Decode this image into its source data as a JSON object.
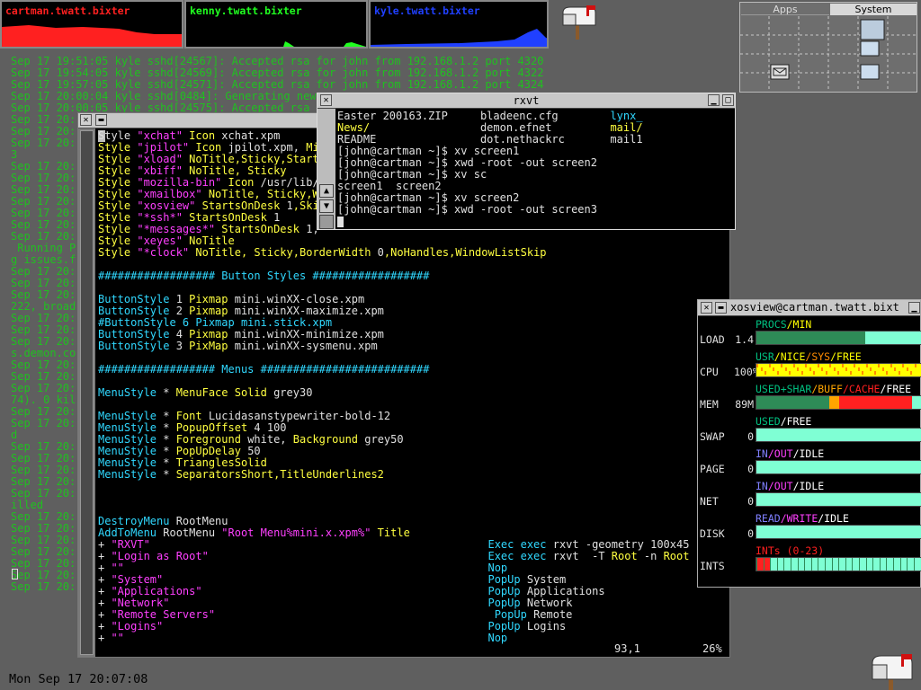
{
  "load_monitors": [
    {
      "label": "cartman.twatt.bixter",
      "color": "#ff2020"
    },
    {
      "label": "kenny.twatt.bixter",
      "color": "#20ff20"
    },
    {
      "label": "kyle.twatt.bixter",
      "color": "#2040ff"
    }
  ],
  "pager": {
    "tabs": [
      "Apps",
      "System"
    ]
  },
  "background_log": [
    "Sep 17 19:51:05 kyle sshd[24567]: Accepted rsa for john from 192.168.1.2 port 4320",
    "Sep 17 19:54:05 kyle sshd[24569]: Accepted rsa for john from 192.168.1.2 port 4322",
    "Sep 17 19:57:05 kyle sshd[24571]: Accepted rsa for john from 192.168.1.2 port 4324",
    "Sep 17 20:00:04 kyle sshd[0484]: Generating new",
    "Sep 17 20:00:05 kyle sshd[24575]: Accepted rsa f",
    "Sep 17 20:",
    "Sep 17 20:",
    "Sep 17 20:",
    "3",
    "Sep 17 20:",
    "Sep 17 20:",
    "Sep 17 20:",
    "Sep 17 20:",
    "Sep 17 20:",
    "Sep 17 20:",
    "Sep 17 20:",
    " Running P",
    "g issues.f",
    "Sep 17 20:",
    "Sep 17 20:",
    "Sep 17 20:",
    "222, broad",
    "Sep 17 20:",
    "Sep 17 20:",
    "Sep 17 20:",
    "s.demon.co",
    "Sep 17 20:",
    "Sep 17 20:",
    "Sep 17 20:",
    "74). 0 kil",
    "Sep 17 20:",
    "Sep 17 20:",
    "d",
    "Sep 17 20:",
    "Sep 17 20:",
    "Sep 17 20:",
    "Sep 17 20:",
    "Sep 17 20:",
    "illed",
    "Sep 17 20:",
    "Sep 17 20:",
    "Sep 17 20:",
    "Sep 17 20:",
    "Sep 17 20:",
    "Sep 17 20:",
    "Sep 17 20:"
  ],
  "vim": {
    "lines": [
      [
        [
          "w",
          "Style "
        ],
        [
          "m",
          "\"xchat\""
        ],
        [
          "y",
          " Icon "
        ],
        [
          "w",
          "xchat.xpm"
        ]
      ],
      [
        [
          "y",
          "Style "
        ],
        [
          "m",
          "\"jpilot\""
        ],
        [
          "y",
          " Icon "
        ],
        [
          "w",
          "jpilot.xpm, "
        ],
        [
          "y",
          "Min"
        ]
      ],
      [
        [
          "y",
          "Style "
        ],
        [
          "m",
          "\"xload\""
        ],
        [
          "y",
          " NoTitle,Sticky,StartsO"
        ]
      ],
      [
        [
          "y",
          "Style "
        ],
        [
          "m",
          "\"xbiff\""
        ],
        [
          "y",
          " NoTitle, Sticky"
        ]
      ],
      [
        [
          "y",
          "Style "
        ],
        [
          "m",
          "\"mozilla-bin\""
        ],
        [
          "y",
          " Icon "
        ],
        [
          "w",
          "/usr/lib/m"
        ]
      ],
      [
        [
          "y",
          "Style "
        ],
        [
          "m",
          "\"xmailbox\""
        ],
        [
          "y",
          " NoTitle, Sticky,Wi"
        ]
      ],
      [
        [
          "y",
          "Style "
        ],
        [
          "m",
          "\"xosview\""
        ],
        [
          "y",
          " StartsOnDesk "
        ],
        [
          "w",
          "1"
        ],
        [
          "y",
          ",Skip"
        ]
      ],
      [
        [
          "y",
          "Style "
        ],
        [
          "m",
          "\"*ssh*\""
        ],
        [
          "y",
          " StartsOnDesk "
        ],
        [
          "w",
          "1"
        ]
      ],
      [
        [
          "y",
          "Style "
        ],
        [
          "m",
          "\"*messages*\""
        ],
        [
          "y",
          " StartsOnDesk "
        ],
        [
          "w",
          "1,"
        ]
      ],
      [
        [
          "y",
          "Style "
        ],
        [
          "m",
          "\"xeyes\""
        ],
        [
          "y",
          " NoTitle"
        ]
      ],
      [
        [
          "y",
          "Style "
        ],
        [
          "m",
          "\"*clock\""
        ],
        [
          "y",
          " NoTitle, Sticky,BorderWidth "
        ],
        [
          "w",
          "0"
        ],
        [
          "y",
          ",NoHandles,WindowListSkip"
        ]
      ],
      [],
      [
        [
          "c",
          "################## Button Styles ##################"
        ]
      ],
      [],
      [
        [
          "c",
          "ButtonStyle "
        ],
        [
          "w",
          "1 "
        ],
        [
          "y",
          "Pixmap "
        ],
        [
          "w",
          "mini.winXX-close.xpm"
        ]
      ],
      [
        [
          "c",
          "ButtonStyle "
        ],
        [
          "w",
          "2 "
        ],
        [
          "y",
          "Pixmap "
        ],
        [
          "w",
          "mini.winXX-maximize.xpm"
        ]
      ],
      [
        [
          "c",
          "#ButtonStyle 6 Pixmap mini.stick.xpm"
        ]
      ],
      [
        [
          "c",
          "ButtonStyle "
        ],
        [
          "w",
          "4 "
        ],
        [
          "y",
          "Pixmap "
        ],
        [
          "w",
          "mini.winXX-minimize.xpm"
        ]
      ],
      [
        [
          "c",
          "ButtonStyle "
        ],
        [
          "w",
          "3 "
        ],
        [
          "y",
          "PixMap "
        ],
        [
          "w",
          "mini.winXX-sysmenu.xpm"
        ]
      ],
      [],
      [
        [
          "c",
          "################## Menus ##########################"
        ]
      ],
      [],
      [
        [
          "c",
          "MenuStyle "
        ],
        [
          "w",
          "* "
        ],
        [
          "y",
          "MenuFace Solid "
        ],
        [
          "w",
          "grey30"
        ]
      ],
      [],
      [
        [
          "c",
          "MenuStyle "
        ],
        [
          "w",
          "* "
        ],
        [
          "y",
          "Font "
        ],
        [
          "w",
          "Lucidasanstypewriter-bold-12"
        ]
      ],
      [
        [
          "c",
          "MenuStyle "
        ],
        [
          "w",
          "* "
        ],
        [
          "y",
          "PopupOffset "
        ],
        [
          "w",
          "4 100"
        ]
      ],
      [
        [
          "c",
          "MenuStyle "
        ],
        [
          "w",
          "* "
        ],
        [
          "y",
          "Foreground "
        ],
        [
          "w",
          "white, "
        ],
        [
          "y",
          "Background "
        ],
        [
          "w",
          "grey50"
        ]
      ],
      [
        [
          "c",
          "MenuStyle "
        ],
        [
          "w",
          "* "
        ],
        [
          "y",
          "PopUpDelay "
        ],
        [
          "w",
          "50"
        ]
      ],
      [
        [
          "c",
          "MenuStyle "
        ],
        [
          "w",
          "* "
        ],
        [
          "y",
          "TrianglesSolid"
        ]
      ],
      [
        [
          "c",
          "MenuStyle "
        ],
        [
          "w",
          "* "
        ],
        [
          "y",
          "SeparatorsShort,TitleUnderlines2"
        ]
      ],
      [],
      [],
      [],
      [
        [
          "c",
          "DestroyMenu "
        ],
        [
          "w",
          "RootMenu"
        ]
      ],
      [
        [
          "c",
          "AddToMenu "
        ],
        [
          "w",
          "RootMenu "
        ],
        [
          "m",
          "\"Root Menu%mini.x.xpm%\""
        ],
        [
          "y",
          " Title"
        ]
      ],
      [
        [
          "w",
          "+ "
        ],
        [
          "m",
          "\"RXVT\"                                                    "
        ],
        [
          "c",
          "Exec exec "
        ],
        [
          "w",
          "rxvt -geometry 100x45"
        ]
      ],
      [
        [
          "w",
          "+ "
        ],
        [
          "m",
          "\"Login as Root\"                                           "
        ],
        [
          "c",
          "Exec exec "
        ],
        [
          "w",
          "rxvt  -T "
        ],
        [
          "y",
          "Root "
        ],
        [
          "w",
          "-n "
        ],
        [
          "y",
          "Root "
        ],
        [
          "w",
          "-g"
        ]
      ],
      [
        [
          "w",
          "+ "
        ],
        [
          "m",
          "\"\"                                                        "
        ],
        [
          "c",
          "Nop"
        ]
      ],
      [
        [
          "w",
          "+ "
        ],
        [
          "m",
          "\"System\"                                                  "
        ],
        [
          "c",
          "PopUp "
        ],
        [
          "w",
          "System"
        ]
      ],
      [
        [
          "w",
          "+ "
        ],
        [
          "m",
          "\"Applications\"                                            "
        ],
        [
          "c",
          "PopUp "
        ],
        [
          "w",
          "Applications"
        ]
      ],
      [
        [
          "w",
          "+ "
        ],
        [
          "m",
          "\"Network\"                                                 "
        ],
        [
          "c",
          "PopUp "
        ],
        [
          "w",
          "Network"
        ]
      ],
      [
        [
          "w",
          "+ "
        ],
        [
          "m",
          "\"Remote Servers\"                                          "
        ],
        [
          "c",
          " PopUp "
        ],
        [
          "w",
          "Remote"
        ]
      ],
      [
        [
          "w",
          "+ "
        ],
        [
          "m",
          "\"Logins\"                                                  "
        ],
        [
          "c",
          "PopUp "
        ],
        [
          "w",
          "Logins"
        ]
      ],
      [
        [
          "w",
          "+ "
        ],
        [
          "m",
          "\"\"                                                        "
        ],
        [
          "c",
          "Nop"
        ]
      ]
    ],
    "ruler_pos": "93,1",
    "ruler_pct": "26%"
  },
  "rxvt": {
    "title": "rxvt",
    "lines": [
      [
        [
          "w",
          "Easter 200163.ZIP     bladeenc.cfg        "
        ],
        [
          "c",
          "lynx_"
        ]
      ],
      [
        [
          "y",
          "News/                 "
        ],
        [
          "w",
          "demon.efnet         "
        ],
        [
          "y",
          "mail/"
        ]
      ],
      [
        [
          "w",
          "README                dot.nethackrc       mail1"
        ]
      ],
      [
        [
          "w",
          "[john@cartman ~]$ xv screen1"
        ]
      ],
      [
        [
          "w",
          "[john@cartman ~]$ xwd -root -out screen2"
        ]
      ],
      [
        [
          "w",
          "[john@cartman ~]$ xv sc"
        ]
      ],
      [
        [
          "w",
          "screen1  screen2"
        ]
      ],
      [
        [
          "w",
          "[john@cartman ~]$ xv screen2"
        ]
      ],
      [
        [
          "w",
          "[john@cartman ~]$ xwd -root -out screen3"
        ]
      ]
    ]
  },
  "xosview": {
    "title": "xosview@cartman.twatt.bixt",
    "meters": [
      {
        "name": "LOAD",
        "value": "1.4",
        "legend": [
          [
            "#00c080",
            "PROCS"
          ],
          [
            "#ffff00",
            "/MIN"
          ]
        ],
        "segments": [
          [
            "#2e8b57",
            0.66
          ],
          [
            "#7fffd4",
            0.34
          ]
        ]
      },
      {
        "name": "CPU",
        "value": "100%",
        "legend": [
          [
            "#00c080",
            "USR"
          ],
          [
            "#ffff00",
            "/NICE"
          ],
          [
            "#ff8c00",
            "/SYS"
          ],
          [
            "#ffff00",
            "/FREE"
          ]
        ],
        "segments": [
          [
            "#ffff00",
            1.0
          ]
        ]
      },
      {
        "name": "MEM",
        "value": "89M",
        "legend": [
          [
            "#00c080",
            "USED+SHAR"
          ],
          [
            "#ffa500",
            "/BUFF"
          ],
          [
            "#ff2020",
            "/CACHE"
          ],
          [
            "#ffffff",
            "/FREE"
          ]
        ],
        "segments": [
          [
            "#2e8b57",
            0.44
          ],
          [
            "#ffa500",
            0.06
          ],
          [
            "#ff2020",
            0.44
          ],
          [
            "#7fffd4",
            0.06
          ]
        ]
      },
      {
        "name": "SWAP",
        "value": "0",
        "legend": [
          [
            "#00c080",
            "USED"
          ],
          [
            "#ffffff",
            "/FREE"
          ]
        ],
        "segments": [
          [
            "#7fffd4",
            1.0
          ]
        ]
      },
      {
        "name": "PAGE",
        "value": "0",
        "legend": [
          [
            "#8080ff",
            "IN"
          ],
          [
            "#ff40ff",
            "/OUT"
          ],
          [
            "#ffffff",
            "/IDLE"
          ]
        ],
        "segments": [
          [
            "#7fffd4",
            1.0
          ]
        ]
      },
      {
        "name": "NET",
        "value": "0",
        "legend": [
          [
            "#8080ff",
            "IN"
          ],
          [
            "#ff40ff",
            "/OUT"
          ],
          [
            "#ffffff",
            "/IDLE"
          ]
        ],
        "segments": [
          [
            "#7fffd4",
            1.0
          ]
        ]
      },
      {
        "name": "DISK",
        "value": "0",
        "legend": [
          [
            "#8080ff",
            "READ"
          ],
          [
            "#ff40ff",
            "/WRITE"
          ],
          [
            "#ffffff",
            "/IDLE"
          ]
        ],
        "segments": [
          [
            "#7fffd4",
            1.0
          ]
        ]
      },
      {
        "name": "INTS",
        "value": "",
        "legend": [
          [
            "#ff2020",
            "INTs (0-23)"
          ]
        ],
        "segments": [
          [
            "#ff2020",
            0.09
          ],
          [
            "#7fffd4",
            0.91
          ]
        ]
      }
    ]
  },
  "clock": "Mon Sep 17 20:07:08"
}
